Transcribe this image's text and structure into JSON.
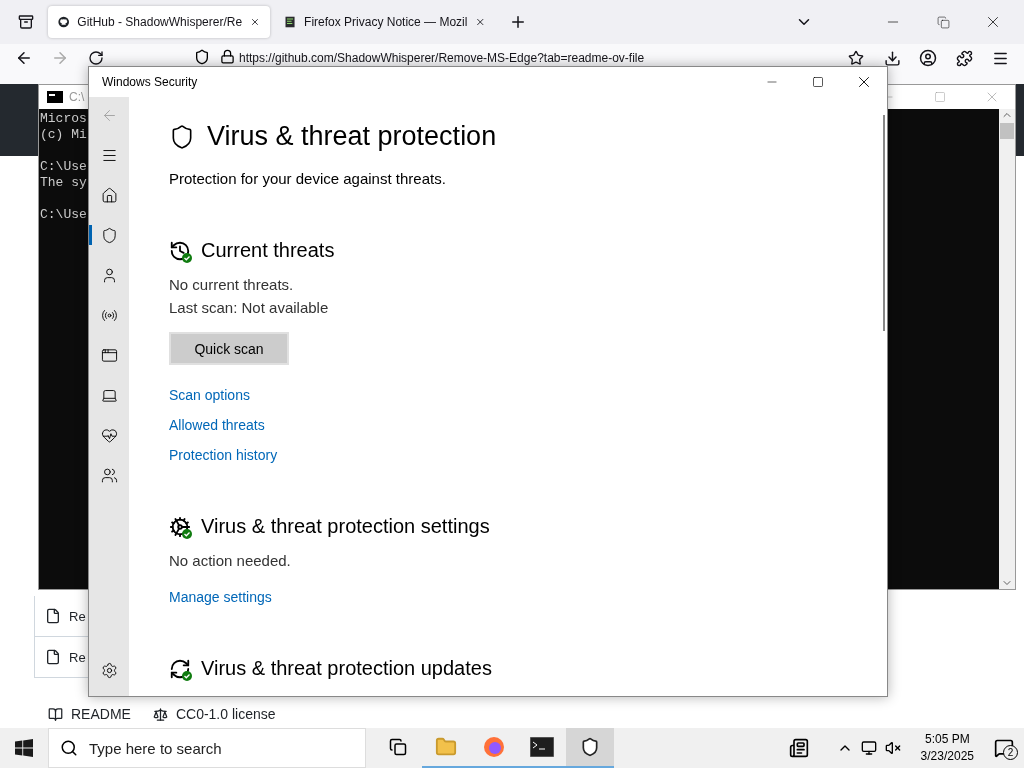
{
  "browser": {
    "tabs": [
      {
        "title": "GitHub - ShadowWhisperer/Re",
        "selected": true
      },
      {
        "title": "Firefox Privacy Notice — Mozil",
        "selected": false
      }
    ],
    "url": "https://github.com/ShadowWhisperer/Remove-MS-Edge?tab=readme-ov-file",
    "files": [
      "Re",
      "Re"
    ],
    "readme_tabs": [
      {
        "kind": "readme",
        "label": "README"
      },
      {
        "kind": "license",
        "label": "CC0-1.0 license"
      }
    ]
  },
  "console": {
    "title": "C:\\",
    "blocks": [
      [
        "Micros",
        "(c) Mi"
      ],
      [
        "C:\\Use",
        "The sy"
      ],
      [
        "C:\\Use"
      ]
    ]
  },
  "security": {
    "title": "Windows Security",
    "nav": [
      {
        "kind": "back",
        "disabled": true
      },
      {
        "kind": "menu",
        "selected": false
      },
      {
        "kind": "home",
        "selected": false
      },
      {
        "kind": "shield",
        "selected": true
      },
      {
        "kind": "account",
        "selected": false
      },
      {
        "kind": "network",
        "selected": false
      },
      {
        "kind": "app",
        "selected": false
      },
      {
        "kind": "device",
        "selected": false
      },
      {
        "kind": "health",
        "selected": false
      },
      {
        "kind": "family",
        "selected": false
      },
      {
        "kind": "settings",
        "selected": false
      }
    ],
    "heading": "Virus & threat protection",
    "subtitle": "Protection for your device against threats.",
    "sections": [
      {
        "kind": "threats",
        "title": "Current threats",
        "lines": [
          "No current threats.",
          "Last scan: Not available"
        ],
        "button": "Quick scan",
        "links": [
          "Scan options",
          "Allowed threats",
          "Protection history"
        ]
      },
      {
        "kind": "settings",
        "title": "Virus & threat protection settings",
        "lines": [
          "No action needed."
        ],
        "links": [
          "Manage settings"
        ]
      },
      {
        "kind": "updates",
        "title": "Virus & threat protection updates"
      }
    ]
  },
  "taskbar": {
    "search": {
      "placeholder": "Type here to search"
    },
    "apps": [
      {
        "kind": "taskview",
        "running": false,
        "selected": false
      },
      {
        "kind": "explorer",
        "running": true,
        "selected": false
      },
      {
        "kind": "firefox",
        "running": true,
        "selected": false
      },
      {
        "kind": "terminal",
        "running": true,
        "selected": false
      },
      {
        "kind": "security",
        "running": true,
        "selected": true
      }
    ],
    "time": "5:05 PM",
    "date": "3/23/2025",
    "notifications": "2"
  }
}
